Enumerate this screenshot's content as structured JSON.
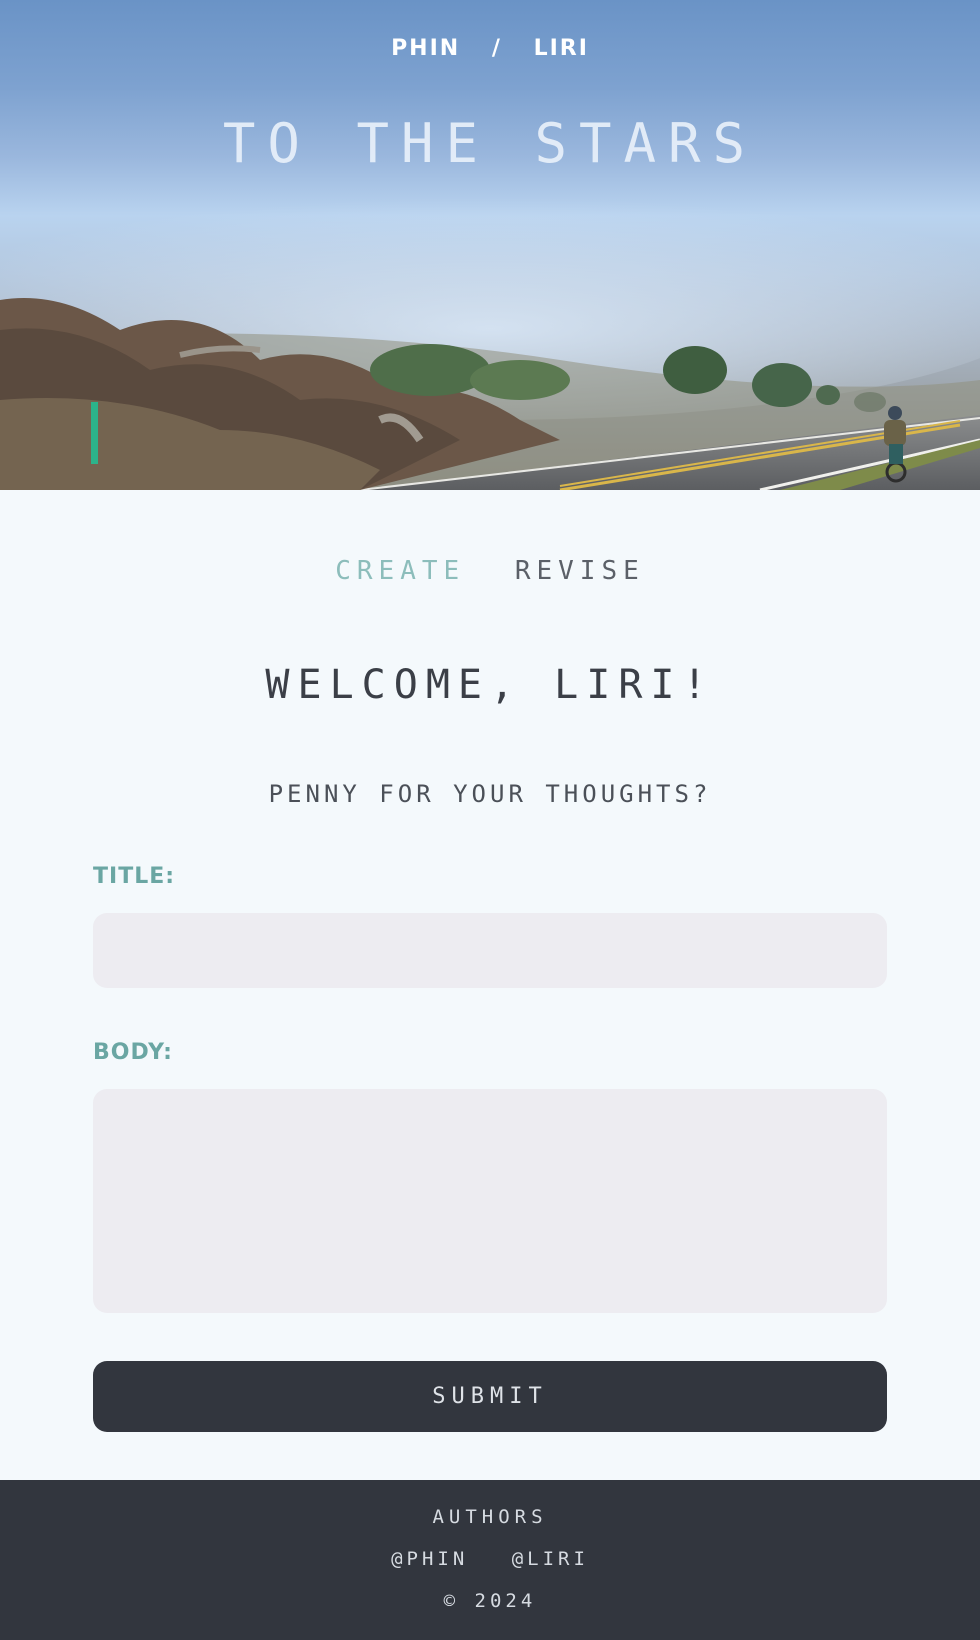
{
  "hero": {
    "author_one": "PHIN",
    "separator": "/",
    "author_two": "LIRI",
    "title": "TO THE STARS"
  },
  "tabs": [
    {
      "label": "CREATE",
      "active": true
    },
    {
      "label": "REVISE",
      "active": false
    }
  ],
  "main": {
    "welcome": "WELCOME, LIRI!",
    "prompt": "PENNY FOR YOUR THOUGHTS?"
  },
  "form": {
    "title_label": "TITLE:",
    "title_value": "",
    "body_label": "BODY:",
    "body_value": "",
    "submit_label": "SUBMIT"
  },
  "footer": {
    "heading": "AUTHORS",
    "link_one": "@PHIN",
    "link_two": "@LIRI",
    "copyright": "© 2024"
  },
  "colors": {
    "page_background": "#f4f9fc",
    "accent_teal": "#6aa6a3",
    "active_tab": "#8cbdbb",
    "dark": "#32363e",
    "input_background": "#edecf1"
  }
}
